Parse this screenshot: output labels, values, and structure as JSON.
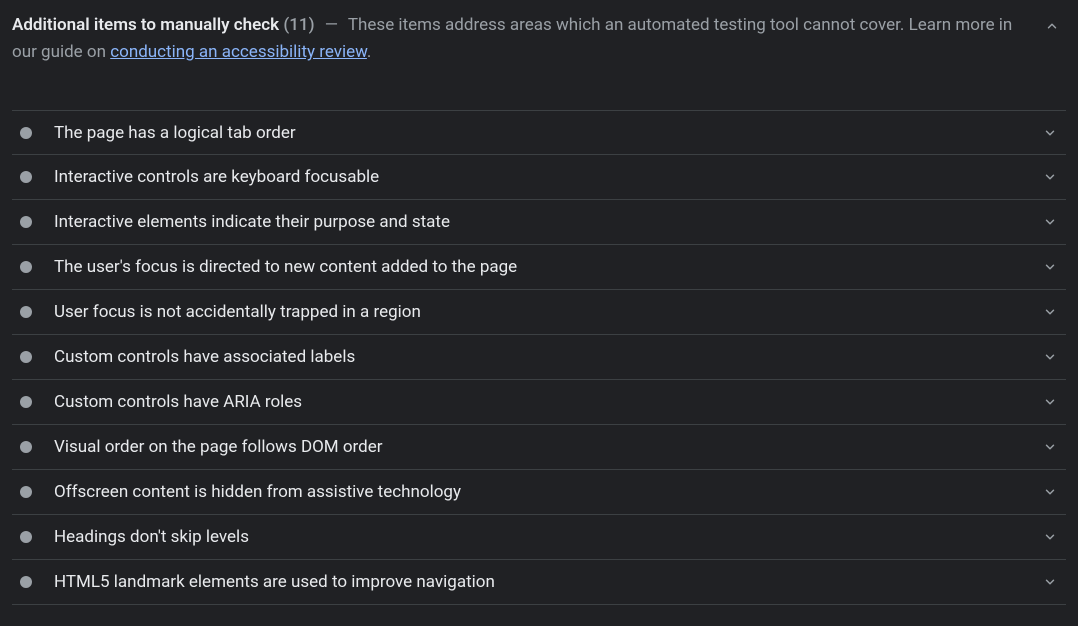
{
  "header": {
    "title": "Additional items to manually check",
    "count": "(11)",
    "separator": "—",
    "description1": "These items address areas which an automated testing tool cannot cover. Learn more in our guide on ",
    "linkText": "conducting an accessibility review",
    "period": "."
  },
  "items": [
    {
      "title": "The page has a logical tab order"
    },
    {
      "title": "Interactive controls are keyboard focusable"
    },
    {
      "title": "Interactive elements indicate their purpose and state"
    },
    {
      "title": "The user's focus is directed to new content added to the page"
    },
    {
      "title": "User focus is not accidentally trapped in a region"
    },
    {
      "title": "Custom controls have associated labels"
    },
    {
      "title": "Custom controls have ARIA roles"
    },
    {
      "title": "Visual order on the page follows DOM order"
    },
    {
      "title": "Offscreen content is hidden from assistive technology"
    },
    {
      "title": "Headings don't skip levels"
    },
    {
      "title": "HTML5 landmark elements are used to improve navigation"
    }
  ]
}
